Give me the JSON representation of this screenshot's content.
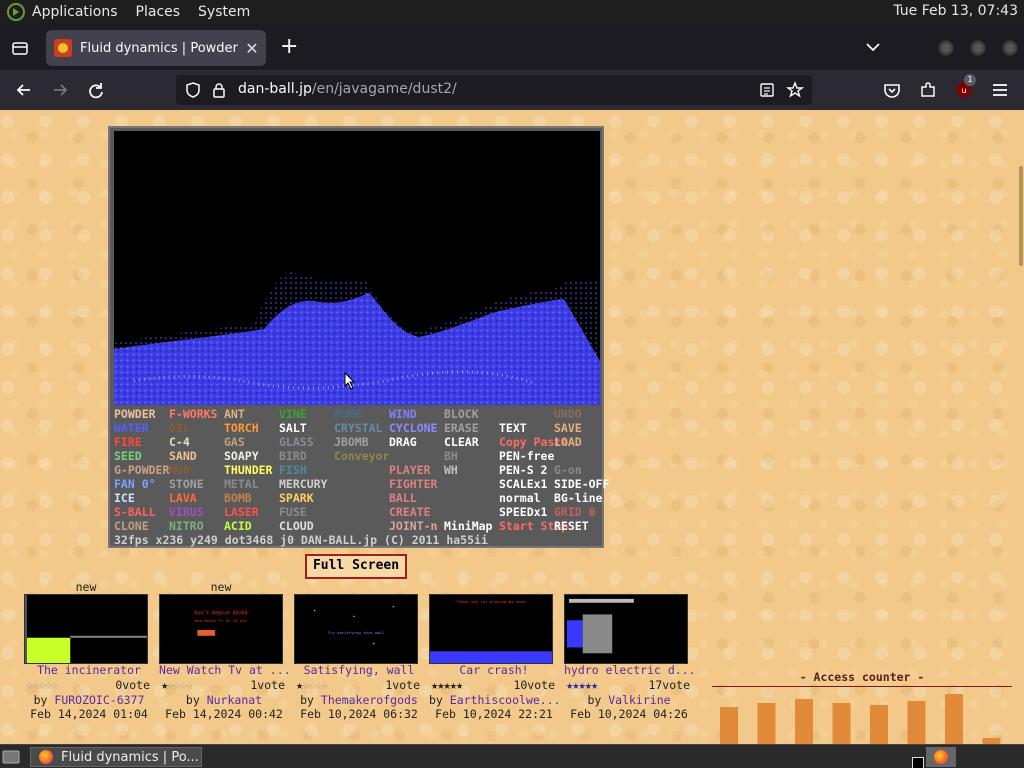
{
  "top_panel": {
    "menus": [
      "Applications",
      "Places",
      "System"
    ],
    "clock": "Tue Feb 13, 07:43"
  },
  "tab": {
    "title": "Fluid dynamics | Powder Ga",
    "close": "✕"
  },
  "new_tab_symbol": "+",
  "urlbar": {
    "host": "dan-ball.jp",
    "path": "/en/javagame/dust2/"
  },
  "extension_badge": "1",
  "game": {
    "menu_rows": [
      [
        [
          "POWDER",
          "#f0c0a0"
        ],
        [
          "F-WORKS",
          "#ff7a6a"
        ],
        [
          "ANT",
          "#e0b080"
        ],
        [
          "VINE",
          "#3aa03a"
        ],
        [
          "PUMP",
          "#4a6a8a"
        ],
        [
          "WIND",
          "#8080ff"
        ],
        [
          "BLOCK",
          "#a0a0a0"
        ],
        [
          "",
          ""
        ],
        [
          "UNDO",
          "#8a6a5a"
        ]
      ],
      [
        [
          "WATER",
          "#5060ff"
        ],
        [
          "OIL",
          "#8a5a3a"
        ],
        [
          "TORCH",
          "#ff9a3a"
        ],
        [
          "SALT",
          "#ffffff"
        ],
        [
          "CRYSTAL",
          "#6a8aa0"
        ],
        [
          "CYCLONE",
          "#8a8aff"
        ],
        [
          "ERASE",
          "#a0a0a0"
        ],
        [
          "TEXT",
          "#ffffff"
        ],
        [
          "SAVE",
          "#e0b080"
        ]
      ],
      [
        [
          "FIRE",
          "#ff4a3a"
        ],
        [
          "C-4",
          "#e0e0c0"
        ],
        [
          "GAS",
          "#c0a080"
        ],
        [
          "GLASS",
          "#8a8a9a"
        ],
        [
          "JBOMB",
          "#a0a0a0"
        ],
        [
          "DRAG",
          "#ffffff"
        ],
        [
          "CLEAR",
          "#ffffff"
        ],
        [
          "Copy Paste",
          "#ff6a6a"
        ],
        [
          "LOAD",
          "#e0b080"
        ]
      ],
      [
        [
          "SEED",
          "#7ad07a"
        ],
        [
          "SAND",
          "#f0c090"
        ],
        [
          "SOAPY",
          "#f0f0e0"
        ],
        [
          "BIRD",
          "#8a8a8a"
        ],
        [
          "Conveyor",
          "#8a8a4a"
        ],
        [
          "",
          ""
        ],
        [
          "BH",
          "#8a8a8a"
        ],
        [
          "PEN-free",
          "#ffffff"
        ],
        [
          "",
          ""
        ]
      ],
      [
        [
          "G-POWDER",
          "#d0a080"
        ],
        [
          "MUD",
          "#8a5a3a"
        ],
        [
          "THUNDER",
          "#ffff60"
        ],
        [
          "FISH",
          "#4a8aa0"
        ],
        [
          "",
          ""
        ],
        [
          "PLAYER",
          "#e08080"
        ],
        [
          "WH",
          "#c0c0c0"
        ],
        [
          "PEN-S 2",
          "#ffffff"
        ],
        [
          "G-on",
          "#8a8a8a"
        ]
      ],
      [
        [
          "FAN 0°",
          "#80a0ff"
        ],
        [
          "STONE",
          "#a0a0a0"
        ],
        [
          "METAL",
          "#8a8a8a"
        ],
        [
          "MERCURY",
          "#d0d0d0"
        ],
        [
          "",
          ""
        ],
        [
          "FIGHTER",
          "#e08080"
        ],
        [
          "",
          ""
        ],
        [
          "SCALEx1",
          "#ffffff"
        ],
        [
          "SIDE-OFF",
          "#ffffff"
        ]
      ],
      [
        [
          "ICE",
          "#d0e0ff"
        ],
        [
          "LAVA",
          "#ff6a3a"
        ],
        [
          "BOMB",
          "#c08050"
        ],
        [
          "SPARK",
          "#ffd060"
        ],
        [
          "",
          ""
        ],
        [
          "BALL",
          "#e08080"
        ],
        [
          "",
          ""
        ],
        [
          "normal",
          "#ffffff"
        ],
        [
          "BG-line",
          "#ffffff"
        ]
      ],
      [
        [
          "S-BALL",
          "#ff6060"
        ],
        [
          "VIRUS",
          "#a050c0"
        ],
        [
          "LASER",
          "#ff5050"
        ],
        [
          "FUSE",
          "#8a8a8a"
        ],
        [
          "",
          ""
        ],
        [
          "CREATE",
          "#e08080"
        ],
        [
          "",
          ""
        ],
        [
          "SPEEDx1",
          "#ffffff"
        ],
        [
          "GRID 0",
          "#c06060"
        ]
      ],
      [
        [
          "CLONE",
          "#c0a080"
        ],
        [
          "NITRO",
          "#7ab07a"
        ],
        [
          "ACID",
          "#c0ff40"
        ],
        [
          "CLOUD",
          "#e0e0e0"
        ],
        [
          "",
          ""
        ],
        [
          "JOINT-n",
          "#e0a0a0"
        ],
        [
          "MiniMap",
          "#ffffff"
        ],
        [
          "Start Stop",
          "#ff6a6a"
        ],
        [
          "RESET",
          "#ffffff"
        ]
      ]
    ],
    "status_line": "32fps  x236 y249 dot3468 j0  DAN-BALL.jp (C) 2011 ha55ii"
  },
  "fullscreen_label": "Full Screen",
  "thumbnails": [
    {
      "new": "new",
      "title": "The incinerator",
      "stars": 0,
      "votes": "0vote",
      "author": "FUROZOIC-6377",
      "date": "Feb 14,2024 01:04",
      "star_color": "#222"
    },
    {
      "new": "new",
      "title": "New Watch Tv at ...",
      "stars": 1,
      "votes": "1vote",
      "author": "Nurkanat",
      "date": "Feb 14,2024 00:42",
      "star_color": "#222"
    },
    {
      "new": "",
      "title": "Satisfying, wall",
      "stars": 1,
      "votes": "1vote",
      "author": "Themakerofgods",
      "date": "Feb 10,2024 06:32",
      "star_color": "#222"
    },
    {
      "new": "",
      "title": "Car crash!",
      "stars": 5,
      "votes": "10vote",
      "author": "Earthiscoolwe...",
      "date": "Feb 10,2024 22:21",
      "star_color": "#222"
    },
    {
      "new": "",
      "title": "hydro electric d...",
      "stars": 5,
      "votes": "17vote",
      "author": "Valkirine",
      "date": "Feb 10,2024 04:26",
      "star_color": "#2a2aa0"
    }
  ],
  "thumbnail_by": "by",
  "counter": {
    "title": "- Access counter -",
    "values": [
      40,
      44,
      48,
      44,
      42,
      46,
      54,
      6
    ],
    "color": "#e08a3a"
  },
  "taskbar": {
    "window_title": "Fluid dynamics | Po..."
  }
}
